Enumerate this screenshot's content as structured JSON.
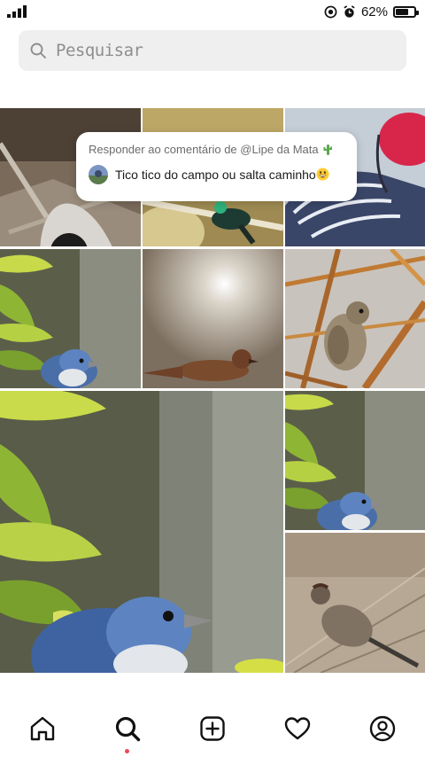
{
  "status_bar": {
    "battery_percent": "62%",
    "battery_level": 0.62,
    "icons": [
      "signal-icon",
      "screen-record-icon",
      "alarm-icon",
      "battery-icon"
    ]
  },
  "search": {
    "placeholder": "Pesquisar",
    "value": ""
  },
  "comment_popup": {
    "header": "Responder ao comentário de @Lipe da Mata",
    "header_emoji": "cactus-icon",
    "text": "Tico tico do campo ou salta caminho",
    "text_emoji": "grinning-face-icon"
  },
  "grid_tiles": [
    {
      "subject": "black-white-bird-photo"
    },
    {
      "subject": "green-bird-on-branch-photo"
    },
    {
      "subject": "red-headed-bird-illustration"
    },
    {
      "subject": "blue-bird-leaves-photo"
    },
    {
      "subject": "brown-bird-on-floor-photo"
    },
    {
      "subject": "sparrow-in-branches-photo"
    },
    {
      "subject": "blue-bird-large-photo"
    },
    {
      "subject": "blue-bird-leaves-photo-small"
    },
    {
      "subject": "brown-bird-in-grass-photo"
    }
  ],
  "bottom_nav": {
    "items": [
      {
        "icon": "home-icon",
        "active": false
      },
      {
        "icon": "search-icon",
        "active": true
      },
      {
        "icon": "create-icon",
        "active": false
      },
      {
        "icon": "heart-icon",
        "active": false
      },
      {
        "icon": "profile-icon",
        "active": false
      }
    ]
  },
  "colors": {
    "search_bg": "#efefef",
    "notification_dot": "#ed4956",
    "text_primary": "#262626",
    "text_secondary": "#8e8e8e"
  }
}
